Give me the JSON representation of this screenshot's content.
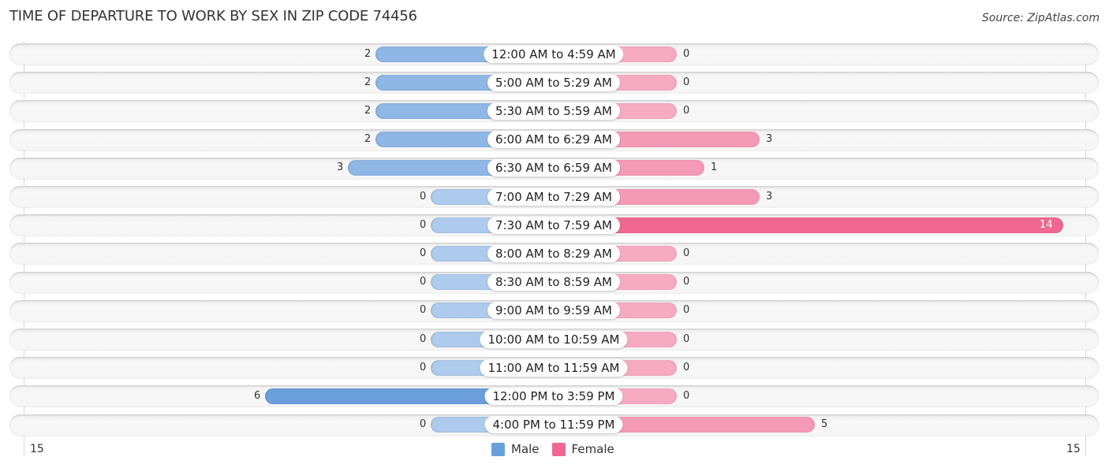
{
  "title": "TIME OF DEPARTURE TO WORK BY SEX IN ZIP CODE 74456",
  "source": "Source: ZipAtlas.com",
  "colors": {
    "male_strong": "#6a9fdb",
    "male_mid": "#8fb7e5",
    "male_light": "#aecaec",
    "female_strong": "#f06891",
    "female_mid": "#f59ab6",
    "female_light": "#f7abc3"
  },
  "chart_data": {
    "type": "bar",
    "orientation": "horizontal-diverging",
    "title": "TIME OF DEPARTURE TO WORK BY SEX IN ZIP CODE 74456",
    "categories": [
      "12:00 AM to 4:59 AM",
      "5:00 AM to 5:29 AM",
      "5:30 AM to 5:59 AM",
      "6:00 AM to 6:29 AM",
      "6:30 AM to 6:59 AM",
      "7:00 AM to 7:29 AM",
      "7:30 AM to 7:59 AM",
      "8:00 AM to 8:29 AM",
      "8:30 AM to 8:59 AM",
      "9:00 AM to 9:59 AM",
      "10:00 AM to 10:59 AM",
      "11:00 AM to 11:59 AM",
      "12:00 PM to 3:59 PM",
      "4:00 PM to 11:59 PM"
    ],
    "series": [
      {
        "name": "Male",
        "values": [
          2,
          2,
          2,
          2,
          3,
          0,
          0,
          0,
          0,
          0,
          0,
          0,
          6,
          0
        ]
      },
      {
        "name": "Female",
        "values": [
          0,
          0,
          0,
          3,
          1,
          3,
          14,
          0,
          0,
          0,
          0,
          0,
          0,
          5
        ]
      }
    ],
    "axis": {
      "left_tick": "15",
      "right_tick": "15",
      "max": 15
    },
    "legend": {
      "position": "bottom-center",
      "entries": [
        "Male",
        "Female"
      ]
    },
    "grid": true
  }
}
